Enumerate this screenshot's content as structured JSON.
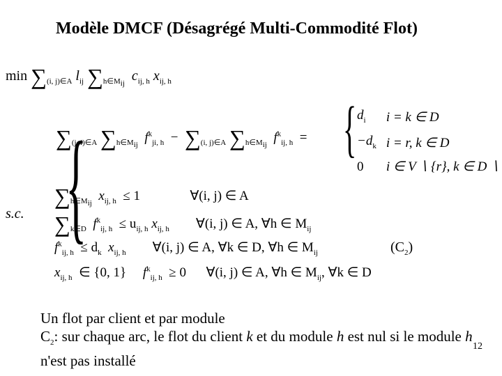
{
  "title": "Modèle DMCF (Désagrégé Multi-Commodité Flot)",
  "objective_label": "min",
  "sc_label": "s.c.",
  "sum_idx1": "(i, j)∈A",
  "sum_idx2": "h∈M",
  "sum_idx2_sub": "ij",
  "sum_idx3": "(j, i)∈A",
  "sum_idx4": "(i, j)∈A",
  "sum_idx5": "k∈D",
  "term_l": "l",
  "term_l_sub": "ij",
  "term_c": "c",
  "term_c_sub": "ij, h",
  "term_x": "x",
  "term_x_sub": "ij, h",
  "f": "f",
  "f_sup": "k",
  "f_sub_ji": "ji, h",
  "f_sub_ij": "ij, h",
  "minus": "−",
  "eq": "=",
  "cases": [
    {
      "lhs": "d",
      "lsub": "i",
      "rhs": "i = k ∈ D"
    },
    {
      "lhs": "−d",
      "lsub": "k",
      "rhs": "i = r, k ∈ D"
    },
    {
      "lhs": "0",
      "lsub": "",
      "rhs": "i ∈ V ∖ {r}, k ∈ D ∖ {i}"
    }
  ],
  "row1_rel": "≤ 1",
  "row1_cond": "∀(i, j) ∈ A",
  "row2_rel": "≤ u",
  "row2_u_sub": "ij, h",
  "row2_cond": "∀(i, j) ∈ A, ∀h ∈ M",
  "row2_cond_sub": "ij",
  "row3_rel": "≤ d",
  "row3_d_sub": "k",
  "row3_cond": "∀(i, j) ∈ A, ∀k ∈ D, ∀h ∈ M",
  "row3_cond_sub": "ij",
  "row4_set": "∈ {0, 1}",
  "row4_rel": "≥ 0",
  "row4_cond": "∀(i, j) ∈ A, ∀h ∈ M",
  "row4_cond_sub": "ij",
  "row4_cond2": ", ∀k ∈ D",
  "c2_label": "(C",
  "c2_sub": "2",
  "c2_close": ")",
  "bottom_line1": "Un flot par client et par module",
  "bottom_line2a": "C",
  "bottom_line2a_sub": "2",
  "bottom_line2b": ": sur chaque arc, le flot du client ",
  "bottom_line2c": "k",
  "bottom_line2d": " et du module ",
  "bottom_line2e": "h",
  "bottom_line2f": " est nul si le module ",
  "bottom_line2g": "h",
  "bottom_line2h": " n'est pas installé",
  "page_number": "12"
}
